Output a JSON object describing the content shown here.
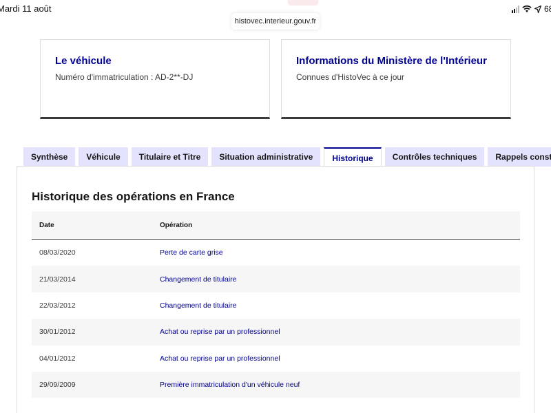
{
  "status_bar": {
    "time": "Mardi 11 août",
    "battery": "68"
  },
  "browser": {
    "url": "histovec.interieur.gouv.fr"
  },
  "vehicle_card": {
    "title": "Le véhicule",
    "text": "Numéro d'immatriculation : AD-2**-DJ"
  },
  "ministry_card": {
    "title": "Informations du Ministère de l'Intérieur",
    "text": "Connues d'HistoVec à ce jour"
  },
  "tabs": [
    {
      "label": "Synthèse",
      "active": false
    },
    {
      "label": "Véhicule",
      "active": false
    },
    {
      "label": "Titulaire et Titre",
      "active": false
    },
    {
      "label": "Situation administrative",
      "active": false
    },
    {
      "label": "Historique",
      "active": true
    },
    {
      "label": "Contrôles techniques",
      "active": false
    },
    {
      "label": "Rappels constructeur",
      "active": false
    }
  ],
  "history": {
    "title": "Historique des opérations en France",
    "columns": {
      "date": "Date",
      "operation": "Opération"
    },
    "rows": [
      {
        "date": "08/03/2020",
        "operation": "Perte de carte grise"
      },
      {
        "date": "21/03/2014",
        "operation": "Changement de titulaire"
      },
      {
        "date": "22/03/2012",
        "operation": "Changement de titulaire"
      },
      {
        "date": "30/01/2012",
        "operation": "Achat ou reprise par un professionnel"
      },
      {
        "date": "04/01/2012",
        "operation": "Achat ou reprise par un professionnel"
      },
      {
        "date": "29/09/2009",
        "operation": "Première immatriculation d'un véhicule neuf"
      }
    ]
  },
  "colors": {
    "accent": "#000091",
    "tab_background": "#e3e3fd",
    "row_alt": "#f6f6f6"
  },
  "icons": [
    "signal-icon",
    "wifi-icon",
    "location-icon"
  ]
}
